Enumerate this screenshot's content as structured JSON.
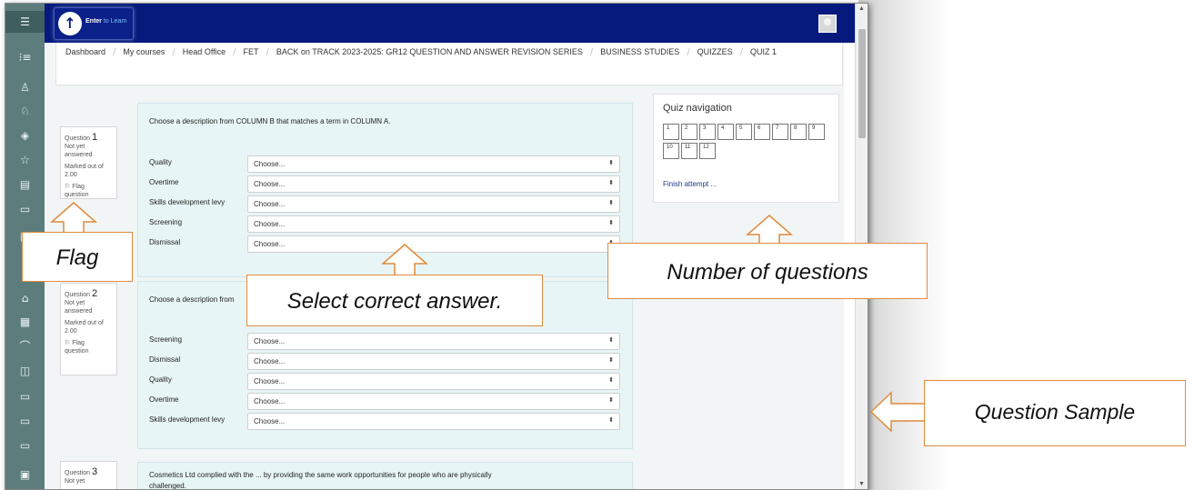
{
  "header": {
    "logo_text_1": "Enter",
    "logo_text_2": " to Learn"
  },
  "breadcrumb": [
    "Dashboard",
    "My courses",
    "Head Office",
    "FET",
    "BACK on TRACK 2023-2025: GR12 QUESTION AND ANSWER REVISION SERIES",
    "BUSINESS STUDIES",
    "QUIZZES",
    "QUIZ 1"
  ],
  "sidebar_icons": [
    "menu-icon",
    "list-icon",
    "users-icon",
    "badge-icon",
    "layers-icon",
    "star-icon",
    "book-icon",
    "folder-icon",
    "calendar-icon",
    "home-icon",
    "calendar-icon",
    "graduation-icon",
    "puzzle-icon",
    "folder-icon",
    "folder-icon",
    "folder-icon",
    "trash-icon"
  ],
  "questions": [
    {
      "prefix": "Question",
      "num": "1",
      "status_1": "Not yet",
      "status_2": "answered",
      "marks_1": "Marked out of",
      "marks_2": "2.00",
      "flag_1": "Flag",
      "flag_2": "question",
      "text": "Choose a description from COLUMN B that matches a term in COLUMN A.",
      "rows": [
        {
          "label": "Quality",
          "value": "Choose..."
        },
        {
          "label": "Overtime",
          "value": "Choose..."
        },
        {
          "label": "Skills development levy",
          "value": "Choose..."
        },
        {
          "label": "Screening",
          "value": "Choose..."
        },
        {
          "label": "Dismissal",
          "value": "Choose..."
        }
      ]
    },
    {
      "prefix": "Question",
      "num": "2",
      "status_1": "Not yet",
      "status_2": "answered",
      "marks_1": "Marked out of",
      "marks_2": "2.00",
      "flag_1": "Flag",
      "flag_2": "question",
      "text": "Choose a description from",
      "rows": [
        {
          "label": "Screening",
          "value": "Choose..."
        },
        {
          "label": "Dismissal",
          "value": "Choose..."
        },
        {
          "label": "Quality",
          "value": "Choose..."
        },
        {
          "label": "Overtime",
          "value": "Choose..."
        },
        {
          "label": "Skills development levy",
          "value": "Choose..."
        }
      ]
    },
    {
      "prefix": "Question",
      "num": "3",
      "status_1": "Not yet",
      "text_1": "Cosmetics Ltd complied with the ... by providing the same work opportunities for people who are physically",
      "text_2": "challenged."
    }
  ],
  "quiz_nav": {
    "title": "Quiz navigation",
    "buttons": [
      "1",
      "2",
      "3",
      "4",
      "5",
      "6",
      "7",
      "8",
      "9",
      "10",
      "11",
      "12"
    ],
    "finish": "Finish attempt ..."
  },
  "callouts": {
    "flag": "Flag",
    "select": "Select correct answer.",
    "number": "Number of questions",
    "sample": "Question Sample"
  },
  "colors": {
    "topbar": "#061a7e",
    "rail": "#5d7d7d",
    "callout_border": "#e08a3c"
  }
}
